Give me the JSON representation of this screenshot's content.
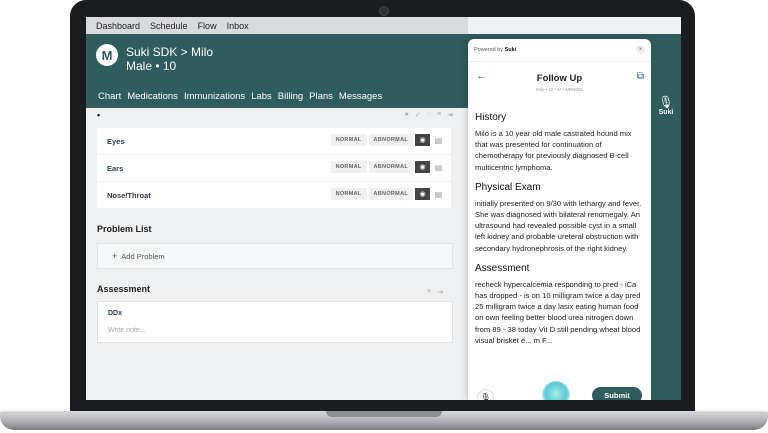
{
  "menubar": {
    "items": [
      "Dashboard",
      "Schedule",
      "Flow",
      "Inbox"
    ]
  },
  "patient": {
    "initial": "M",
    "title": "Suki SDK > Milo",
    "subtitle": "Male • 10",
    "tabs": [
      "Chart",
      "Medications",
      "Immunizations",
      "Labs",
      "Billing",
      "Plans",
      "Messages"
    ]
  },
  "exam": {
    "marker": "•",
    "rows": [
      {
        "label": "Eyes",
        "normal": "NORMAL",
        "abnormal": "ABNORMAL"
      },
      {
        "label": "Ears",
        "normal": "NORMAL",
        "abnormal": "ABNORMAL"
      },
      {
        "label": "Nose/Throat",
        "normal": "NORMAL",
        "abnormal": "ABNORMAL"
      }
    ]
  },
  "problem_list": {
    "title": "Problem List",
    "add_label": "Add Problem",
    "add_icon": "+"
  },
  "assessment": {
    "title": "Assessment",
    "ddx_label": "DDx",
    "placeholder": "Write note..."
  },
  "suki_side": {
    "label": "Suki"
  },
  "panel": {
    "powered_by": "Powered by",
    "brand": "Suki",
    "close": "×",
    "title": "Follow Up",
    "subtitle": "Milo • 10 • M • MRN001",
    "sections": [
      {
        "heading": "History",
        "body": "Milo is a 10 year old male castrated hound mix that was presented for continuation of chemotherapy for previously diagnosed B-cell multicentric lymphoma."
      },
      {
        "heading": "Physical Exam",
        "body": "initially presented on 9/30 with lethargy and fever. She was diagnosed with bilateral renomegaly. An ultrasound had revealed possible cyst in a small left kidney and probable ureteral obstruction with secondary hydronephrosis of the right kidney."
      },
      {
        "heading": "Assessment",
        "body": "recheck hypercalcemia responding to pred - iCa has dropped - is on 10 milligram twice a day pred 25 milligram twice a day lasix eating human food on own feeling better blood urea nitrogen down from 89 - 38 today Vit D still pending wheat blood visual brisket e... m F..."
      }
    ],
    "submit": "Submit"
  },
  "icons": {
    "avatar": "avatar-icon",
    "back": "arrow-left-icon",
    "copy": "copy-icon",
    "close": "close-icon",
    "mic": "microphone-icon",
    "eye": "eye-icon",
    "doc": "document-icon",
    "plus": "plus-icon"
  },
  "colors": {
    "brand": "#2f5c5d",
    "accent": "#2f5c9a"
  }
}
